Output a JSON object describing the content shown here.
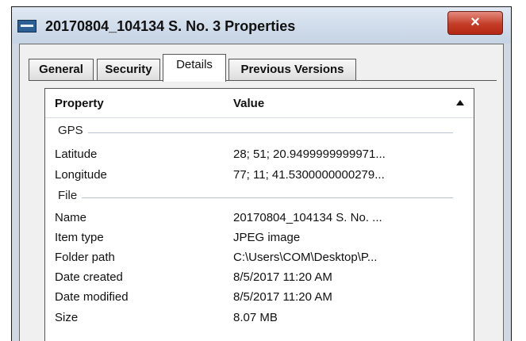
{
  "window": {
    "title": "20170804_104134 S. No. 3 Properties",
    "close_label": "×"
  },
  "tabs": [
    {
      "label": "General"
    },
    {
      "label": "Security"
    },
    {
      "label": "Details"
    },
    {
      "label": "Previous Versions"
    }
  ],
  "details": {
    "header": {
      "property": "Property",
      "value": "Value"
    },
    "groups": {
      "gps": "GPS",
      "file": "File"
    },
    "rows": [
      {
        "property": "Latitude",
        "value": "28; 51; 20.9499999999971..."
      },
      {
        "property": "Longitude",
        "value": "77; 11; 41.5300000000279..."
      },
      {
        "property": "Name",
        "value": "20170804_104134 S. No. ..."
      },
      {
        "property": "Item type",
        "value": "JPEG image"
      },
      {
        "property": "Folder path",
        "value": "C:\\Users\\COM\\Desktop\\P..."
      },
      {
        "property": "Date created",
        "value": "8/5/2017 11:20 AM"
      },
      {
        "property": "Date modified",
        "value": "8/5/2017 11:20 AM"
      },
      {
        "property": "Size",
        "value": "8.07 MB"
      }
    ]
  }
}
